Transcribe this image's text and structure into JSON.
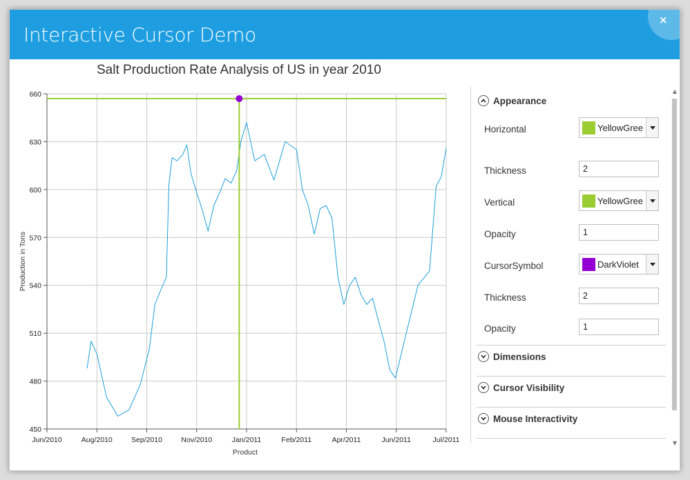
{
  "window": {
    "title": "Interactive Cursor Demo",
    "close_label": "×"
  },
  "chart_data": {
    "type": "line",
    "title": "Salt Production Rate Analysis of US in year 2010",
    "xlabel": "Product",
    "ylabel": "Production in Tons",
    "ylim": [
      450,
      660
    ],
    "yticks": [
      "450",
      "480",
      "510",
      "540",
      "570",
      "600",
      "630",
      "660"
    ],
    "xticks": [
      "Jun/2010",
      "Aug/2010",
      "Sep/2010",
      "Nov/2010",
      "Jan/2011",
      "Feb/2011",
      "Apr/2011",
      "Jun/2011",
      "Jul/2011"
    ],
    "grid": true,
    "series": [
      {
        "color": "#1a9fd9",
        "x": [
          "2010-07-20",
          "2010-07-25",
          "2010-08-01",
          "2010-08-07",
          "2010-08-14",
          "2010-08-21",
          "2010-08-28",
          "2010-09-04",
          "2010-09-11",
          "2010-09-18",
          "2010-09-25",
          "2010-09-28",
          "2010-10-02",
          "2010-10-08",
          "2010-10-15",
          "2010-10-20",
          "2010-10-25",
          "2010-11-01",
          "2010-11-08",
          "2010-11-15",
          "2010-11-22",
          "2010-11-29",
          "2010-12-06",
          "2010-12-13",
          "2010-12-20",
          "2010-12-25",
          "2011-01-01",
          "2011-01-06",
          "2011-01-12",
          "2011-01-18",
          "2011-01-25",
          "2011-02-01",
          "2011-02-08",
          "2011-02-15",
          "2011-02-22",
          "2011-03-01",
          "2011-03-08",
          "2011-03-15",
          "2011-03-22",
          "2011-03-29",
          "2011-04-05",
          "2011-04-12",
          "2011-04-19",
          "2011-04-26",
          "2011-05-03",
          "2011-05-10",
          "2011-05-17",
          "2011-05-24",
          "2011-05-31",
          "2011-06-07",
          "2011-06-14",
          "2011-06-21",
          "2011-06-25",
          "2011-06-28",
          "2011-07-01"
        ],
        "y": [
          488,
          505,
          497,
          470,
          458,
          462,
          478,
          500,
          528,
          537,
          545,
          603,
          620,
          618,
          622,
          628,
          610,
          598,
          587,
          574,
          590,
          598,
          607,
          604,
          612,
          630,
          642,
          618,
          622,
          606,
          630,
          625,
          600,
          590,
          572,
          588,
          590,
          582,
          545,
          528,
          540,
          545,
          534,
          528,
          532,
          518,
          505,
          487,
          482,
          510,
          540,
          549,
          602,
          608,
          626
        ]
      }
    ],
    "cursor": {
      "x": "2010-12-23",
      "y": 657
    }
  },
  "panel": {
    "sections": {
      "appearance": "Appearance",
      "dimensions": "Dimensions",
      "cursor_visibility": "Cursor Visibility",
      "mouse_interactivity": "Mouse Interactivity"
    },
    "props": {
      "horizontal_label": "Horizontal",
      "horizontal_color_name": "YellowGree",
      "horizontal_color": "#9ACD32",
      "thickness1_label": "Thickness",
      "thickness1_value": "2",
      "vertical_label": "Vertical",
      "vertical_color_name": "YellowGree",
      "vertical_color": "#9ACD32",
      "opacity1_label": "Opacity",
      "opacity1_value": "1",
      "cursor_symbol_label": "CursorSymbol",
      "cursor_symbol_color_name": "DarkViolet",
      "cursor_symbol_color": "#9400D3",
      "thickness2_label": "Thickness",
      "thickness2_value": "2",
      "opacity2_label": "Opacity",
      "opacity2_value": "1"
    }
  },
  "colors": {
    "titlebar": "#1e9ee0",
    "line": "#1a9fd9",
    "cursor_line": "#9ACD32",
    "cursor_symbol": "#9400D3"
  }
}
